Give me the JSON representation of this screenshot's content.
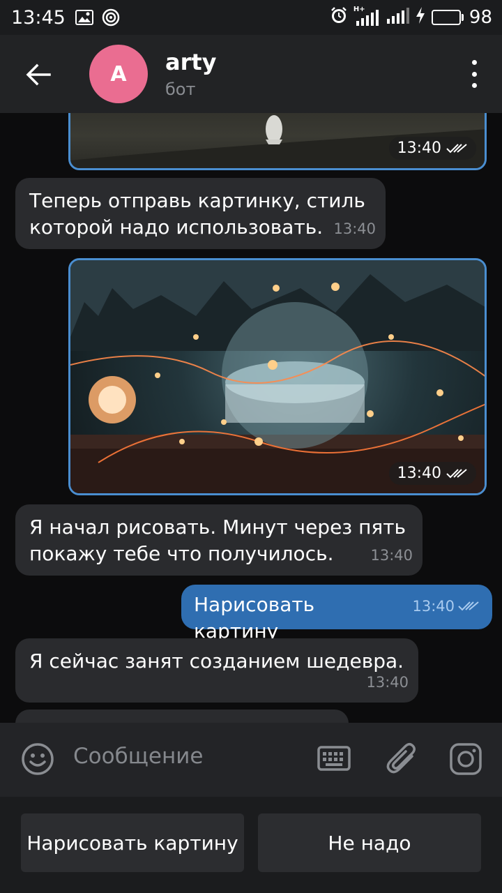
{
  "status_bar": {
    "time": "13:45",
    "network_label": "H+",
    "battery_level": "98",
    "battery_color": "#3ecf4a"
  },
  "header": {
    "avatar_letter": "A",
    "avatar_color": "#ea6d91",
    "title": "arty",
    "subtitle": "бот"
  },
  "messages": [
    {
      "type": "image",
      "direction": "out",
      "time": "13:40",
      "description": "partially visible photo"
    },
    {
      "type": "text",
      "direction": "in",
      "text_lines": [
        "Теперь отправь картинку, стиль",
        "которой надо использовать."
      ],
      "time": "13:40"
    },
    {
      "type": "image",
      "direction": "out",
      "time": "13:40",
      "description": "glass sphere with fairy lights"
    },
    {
      "type": "text",
      "direction": "in",
      "text_lines": [
        "Я начал рисовать. Минут через пять",
        "покажу тебе что получилось."
      ],
      "time": "13:40"
    },
    {
      "type": "text",
      "direction": "out",
      "text": "Нарисовать картину",
      "time": "13:40"
    },
    {
      "type": "text",
      "direction": "in",
      "text": "Я сейчас занят созданием шедевра.",
      "time": "13:40"
    }
  ],
  "input": {
    "placeholder": "Сообщение"
  },
  "bot_keyboard": {
    "buttons": [
      "Нарисовать картину",
      "Не надо"
    ]
  },
  "colors": {
    "accent_blue": "#2f6eb1",
    "incoming_bubble": "#2a2b2e",
    "image_border": "#4a8ed0"
  }
}
